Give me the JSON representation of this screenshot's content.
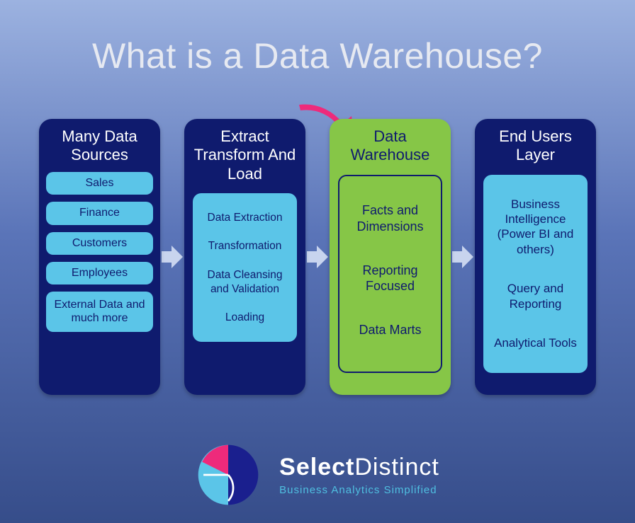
{
  "title": "What is a Data Warehouse?",
  "cards": {
    "sources": {
      "title": "Many Data Sources",
      "items": [
        "Sales",
        "Finance",
        "Customers",
        "Employees",
        "External Data and much more"
      ]
    },
    "etl": {
      "title": "Extract Transform And Load",
      "items": [
        "Data Extraction",
        "Transformation",
        "Data Cleansing and Validation",
        "Loading"
      ]
    },
    "warehouse": {
      "title": "Data Warehouse",
      "items": [
        "Facts and Dimensions",
        "Reporting Focused",
        "Data Marts"
      ]
    },
    "endusers": {
      "title": "End Users Layer",
      "items": [
        "Business Intelligence (Power BI and others)",
        "Query and Reporting",
        "Analytical Tools"
      ]
    }
  },
  "brand": {
    "name_bold": "Select",
    "name_light": "Distinct",
    "tagline": "Business Analytics Simplified"
  }
}
